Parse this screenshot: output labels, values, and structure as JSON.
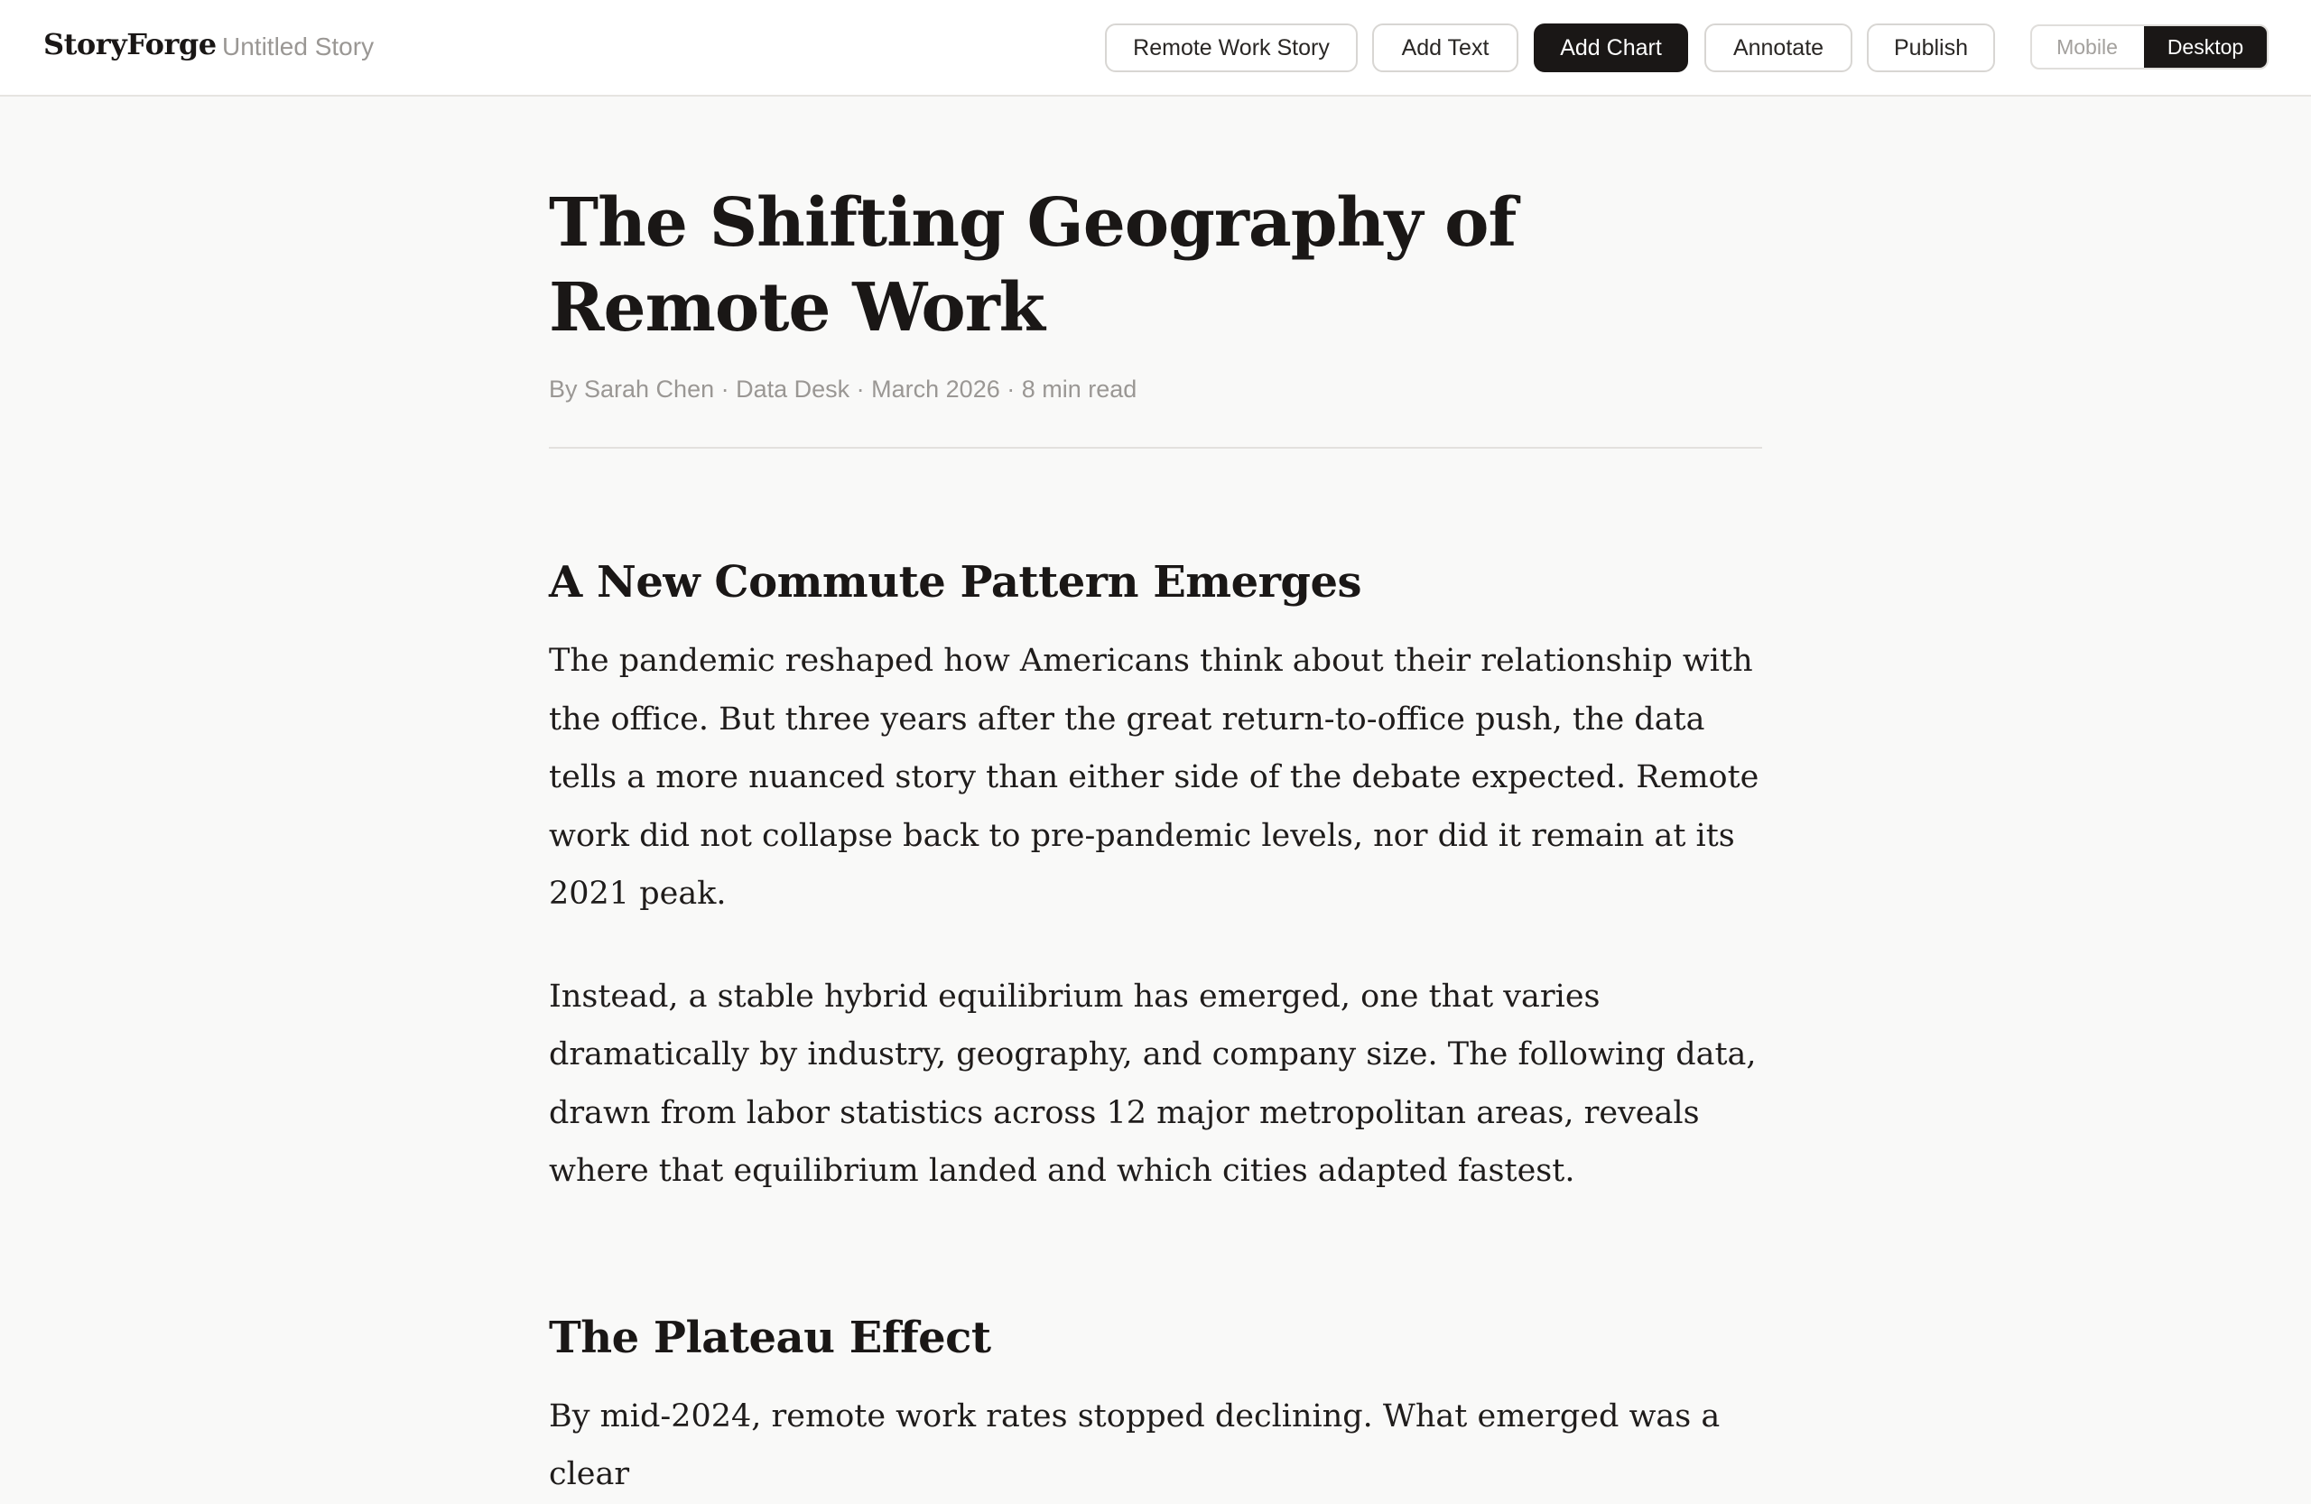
{
  "header": {
    "brand": "StoryForge",
    "story_name": "Untitled Story",
    "buttons": {
      "remote_work_story": "Remote Work Story",
      "add_text": "Add Text",
      "add_chart": "Add Chart",
      "annotate": "Annotate",
      "publish": "Publish"
    },
    "view_toggle": {
      "mobile": "Mobile",
      "desktop": "Desktop",
      "selected": "Desktop"
    }
  },
  "article": {
    "title": "The Shifting Geography of Remote Work",
    "byline": "By Sarah Chen · Data Desk · March 2026 · 8 min read",
    "sections": [
      {
        "heading": "A New Commute Pattern Emerges",
        "paragraphs": [
          "The pandemic reshaped how Americans think about their relationship with the office. But three years after the great return-to-office push, the data tells a more nuanced story than either side of the debate expected. Remote work did not collapse back to pre-pandemic levels, nor did it remain at its 2021 peak.",
          "Instead, a stable hybrid equilibrium has emerged, one that varies dramatically by industry, geography, and company size. The following data, drawn from labor statistics across 12 major metropolitan areas, reveals where that equilibrium landed and which cities adapted fastest."
        ]
      },
      {
        "heading": "The Plateau Effect",
        "paragraphs": [
          "By mid-2024, remote work rates stopped declining. What emerged was a clear"
        ]
      }
    ]
  }
}
